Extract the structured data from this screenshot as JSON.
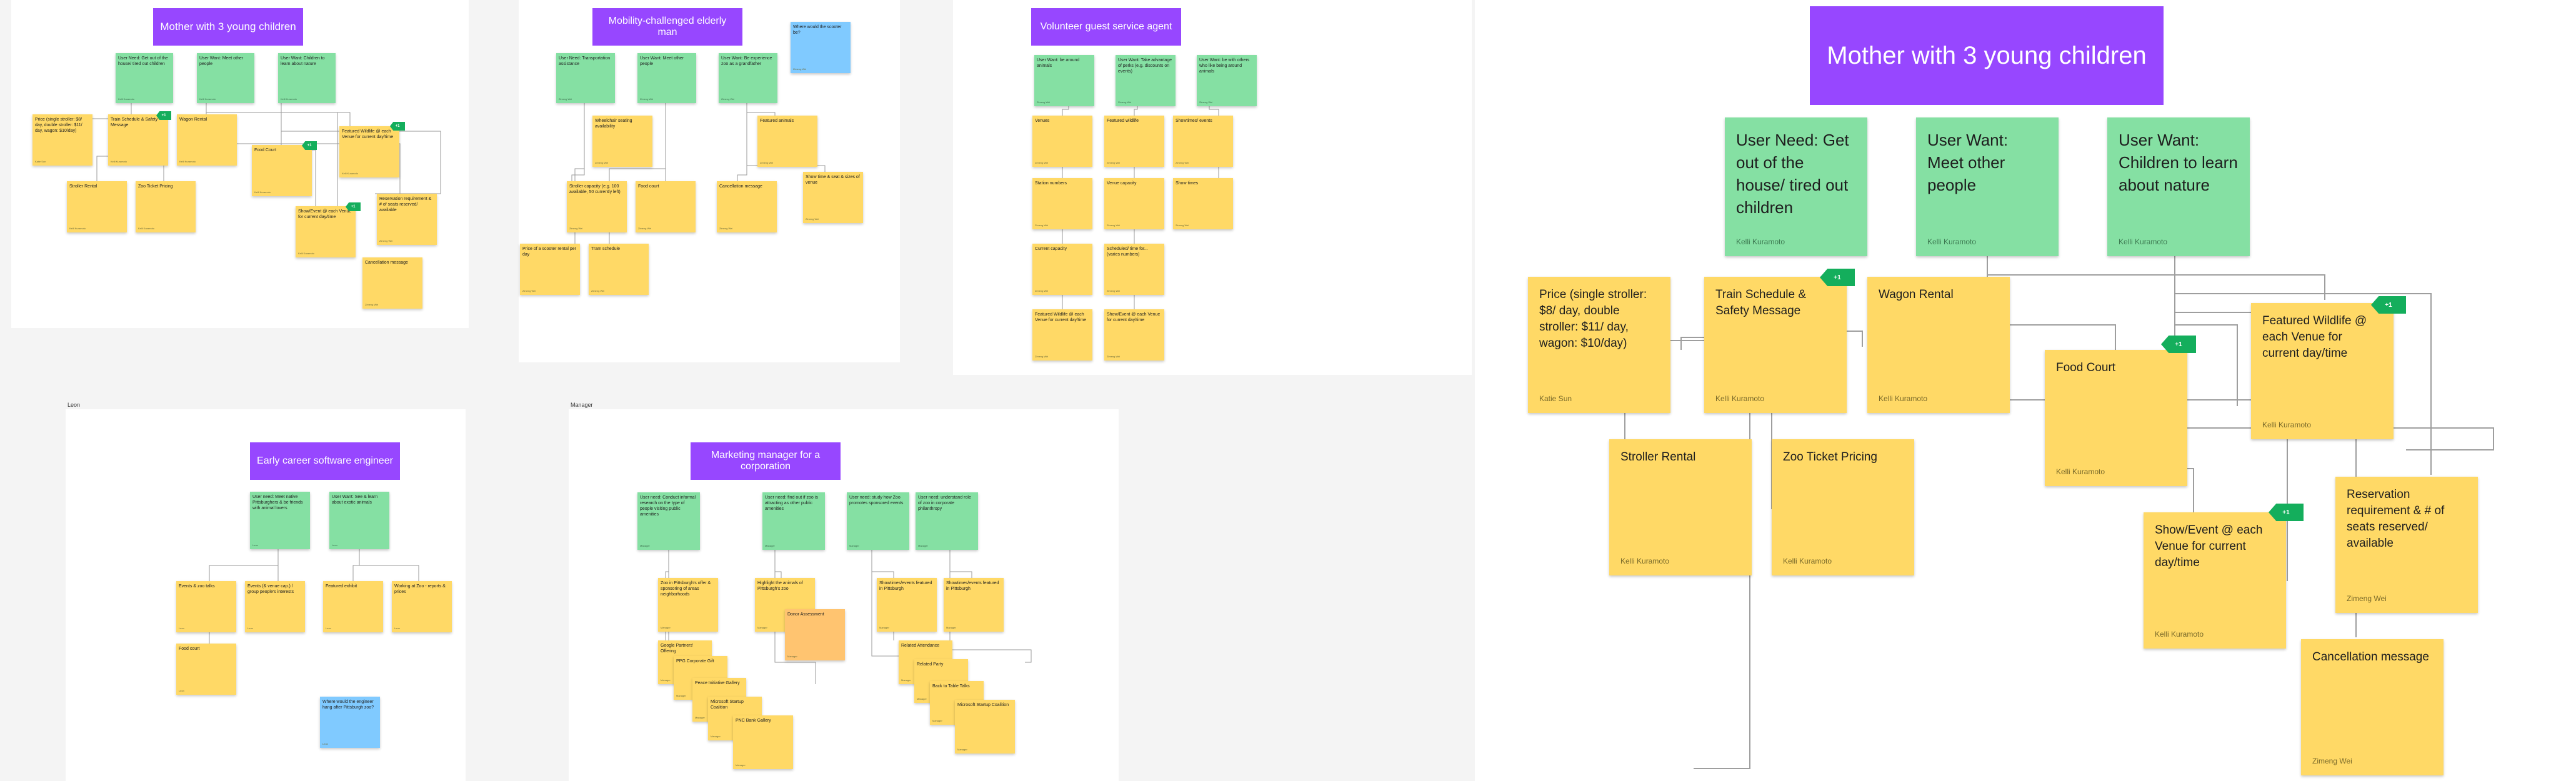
{
  "boards": {
    "mother": {
      "title": "Mother with 3 young children",
      "needs": [
        {
          "text": "User Need: Get out of the house/ tired out children",
          "author": "Kelli Kuramoto"
        },
        {
          "text": "User Want: Meet other people",
          "author": "Kelli Kuramoto"
        },
        {
          "text": "User Want: Children to learn about nature",
          "author": "Kelli Kuramoto"
        }
      ],
      "stickies": [
        {
          "text": "Price (single stroller: $8/ day, double stroller: $11/ day, wagon: $10/day)",
          "author": "Katie Sun"
        },
        {
          "text": "Train Schedule & Safety Message",
          "author": "Kelli Kuramoto",
          "tag": "+1"
        },
        {
          "text": "Wagon Rental",
          "author": "Kelli Kuramoto"
        },
        {
          "text": "Food Court",
          "author": "Kelli Kuramoto",
          "tag": "+1"
        },
        {
          "text": "Featured Wildlife @ each Venue for current day/time",
          "author": "Kelli Kuramoto",
          "tag": "+1"
        },
        {
          "text": "Stroller Rental",
          "author": "Kelli Kuramoto"
        },
        {
          "text": "Zoo Ticket Pricing",
          "author": "Kelli Kuramoto"
        },
        {
          "text": "Show/Event @ each Venue for current day/time",
          "author": "Kelli Kuramoto",
          "tag": "+1"
        },
        {
          "text": "Reservation requirement & # of seats reserved/ available",
          "author": "Zimeng Wei"
        },
        {
          "text": "Cancellation message",
          "author": "Zimeng Wei"
        }
      ]
    },
    "elderly": {
      "title": "Mobility-challenged elderly man",
      "needs": [
        {
          "text": "User Need: Transportation assistance",
          "author": "Zimeng Wei"
        },
        {
          "text": "User Want: Meet other people",
          "author": "Zimeng Wei"
        },
        {
          "text": "User Want: Be experience zoo as a grandfather",
          "author": "Zimeng Wei"
        }
      ],
      "stickies": [
        {
          "text": "Wheelchair seating availability",
          "author": "Zimeng Wei"
        },
        {
          "text": "Featured animals",
          "author": "Zimeng Wei"
        },
        {
          "text": "Stroller capacity (e.g. 100 available, 50 currently left)",
          "author": "Zimeng Wei"
        },
        {
          "text": "Food court",
          "author": "Zimeng Wei"
        },
        {
          "text": "Cancellation message",
          "author": "Zimeng Wei"
        },
        {
          "text": "Show time & seat & sizes of venue",
          "author": "Zimeng Wei"
        },
        {
          "text": "Price of a scooter rental per day",
          "author": "Zimeng Wei"
        },
        {
          "text": "Tram schedule",
          "author": "Zimeng Wei"
        }
      ],
      "comment": {
        "text": "Where would the scooter be?",
        "author": "Zimeng Wei"
      }
    },
    "volunteer": {
      "title": "Volunteer guest service agent",
      "needs": [
        {
          "text": "User Want: be around animals",
          "author": "Zimeng Wei"
        },
        {
          "text": "User Want: Take advantage of perks (e.g. discounts on events)",
          "author": "Zimeng Wei"
        },
        {
          "text": "User Want: be with others who like being around animals",
          "author": "Zimeng Wei"
        }
      ],
      "stickies": [
        {
          "text": "Venues",
          "author": "Zimeng Wei"
        },
        {
          "text": "Featured wildlife",
          "author": "Zimeng Wei"
        },
        {
          "text": "Showtimes/ events",
          "author": "Zimeng Wei"
        },
        {
          "text": "Station numbers",
          "author": "Zimeng Wei"
        },
        {
          "text": "Venue capacity",
          "author": "Zimeng Wei"
        },
        {
          "text": "Show times",
          "author": "Zimeng Wei"
        },
        {
          "text": "Current capacity",
          "author": "Zimeng Wei"
        },
        {
          "text": "Scheduled/ time for... (varies numbers)",
          "author": "Zimeng Wei"
        },
        {
          "text": "Featured Wildlife @ each Venue for current day/time",
          "author": "Zimeng Wei"
        },
        {
          "text": "Show/Event @ each Venue for current day/time",
          "author": "Zimeng Wei"
        }
      ]
    },
    "engineer": {
      "label": "Leon",
      "title": "Early career software engineer",
      "needs": [
        {
          "text": "User need: Meet native Pittsburghers & be friends with animal lovers",
          "author": "Leon"
        },
        {
          "text": "User Want: See & learn about exotic animals",
          "author": "Leon"
        }
      ],
      "stickies": [
        {
          "text": "Events & zoo talks",
          "author": "Leon"
        },
        {
          "text": "Events (& venue cap.) / group people's interests",
          "author": "Leon"
        },
        {
          "text": "Featured exhibit",
          "author": "Leon"
        },
        {
          "text": "Working at Zoo - reports & prices",
          "author": "Leon"
        },
        {
          "text": "Food court",
          "author": "Leon"
        }
      ],
      "comment": {
        "text": "Where would the engineer hang after Pittsburgh zoo?",
        "author": "Leon"
      }
    },
    "marketing": {
      "label": "Manager",
      "title": "Marketing manager for a corporation",
      "needs": [
        {
          "text": "User need: Conduct informal research on the type of people visiting public amenities",
          "author": "Manager"
        },
        {
          "text": "User need: find out if zoo is attracting as other public amenities",
          "author": "Manager"
        },
        {
          "text": "User need: study how Zoo promotes sponsored events",
          "author": "Manager"
        },
        {
          "text": "User need: understand role of zoo in corporate philanthropy",
          "author": "Manager"
        }
      ],
      "stickies": [
        {
          "text": "Zoo in Pittsburgh's offer & sponsoring of areas neighborhoods",
          "author": "Manager"
        },
        {
          "text": "Highlight the animals of Pittsburgh's zoo",
          "author": "Manager"
        },
        {
          "text": "Showtimes/events featured in Pittsburgh",
          "author": "Manager"
        },
        {
          "text": "Showtimes/events featured in Pittsburgh",
          "author": "Manager"
        },
        {
          "text": "Zoo ticket pricing",
          "author": "Manager"
        },
        {
          "text": "Event attendance for the zoo",
          "author": "Manager"
        },
        {
          "text": "Google Partners' Offering",
          "author": "Manager"
        },
        {
          "text": "PPG Corporate Gift",
          "author": "Manager"
        },
        {
          "text": "Peace Initiative Gallery",
          "author": "Manager"
        },
        {
          "text": "Microsoft Startup Coalition",
          "author": "Manager"
        },
        {
          "text": "PNC Bank Gallery",
          "author": "Manager"
        },
        {
          "text": "Related Attendance",
          "author": "Manager"
        },
        {
          "text": "Related Party",
          "author": "Manager"
        },
        {
          "text": "Back to Table Talks",
          "author": "Manager"
        },
        {
          "text": "Microsoft Startup Coalition",
          "author": "Manager"
        }
      ],
      "flag": {
        "text": "Donor Assessment",
        "author": "Manager"
      }
    }
  },
  "colors": {
    "title": "#9747ff",
    "need": "#85e0a3",
    "sticky": "#ffd966",
    "tag": "#14ae5c",
    "comment": "#80caff"
  }
}
